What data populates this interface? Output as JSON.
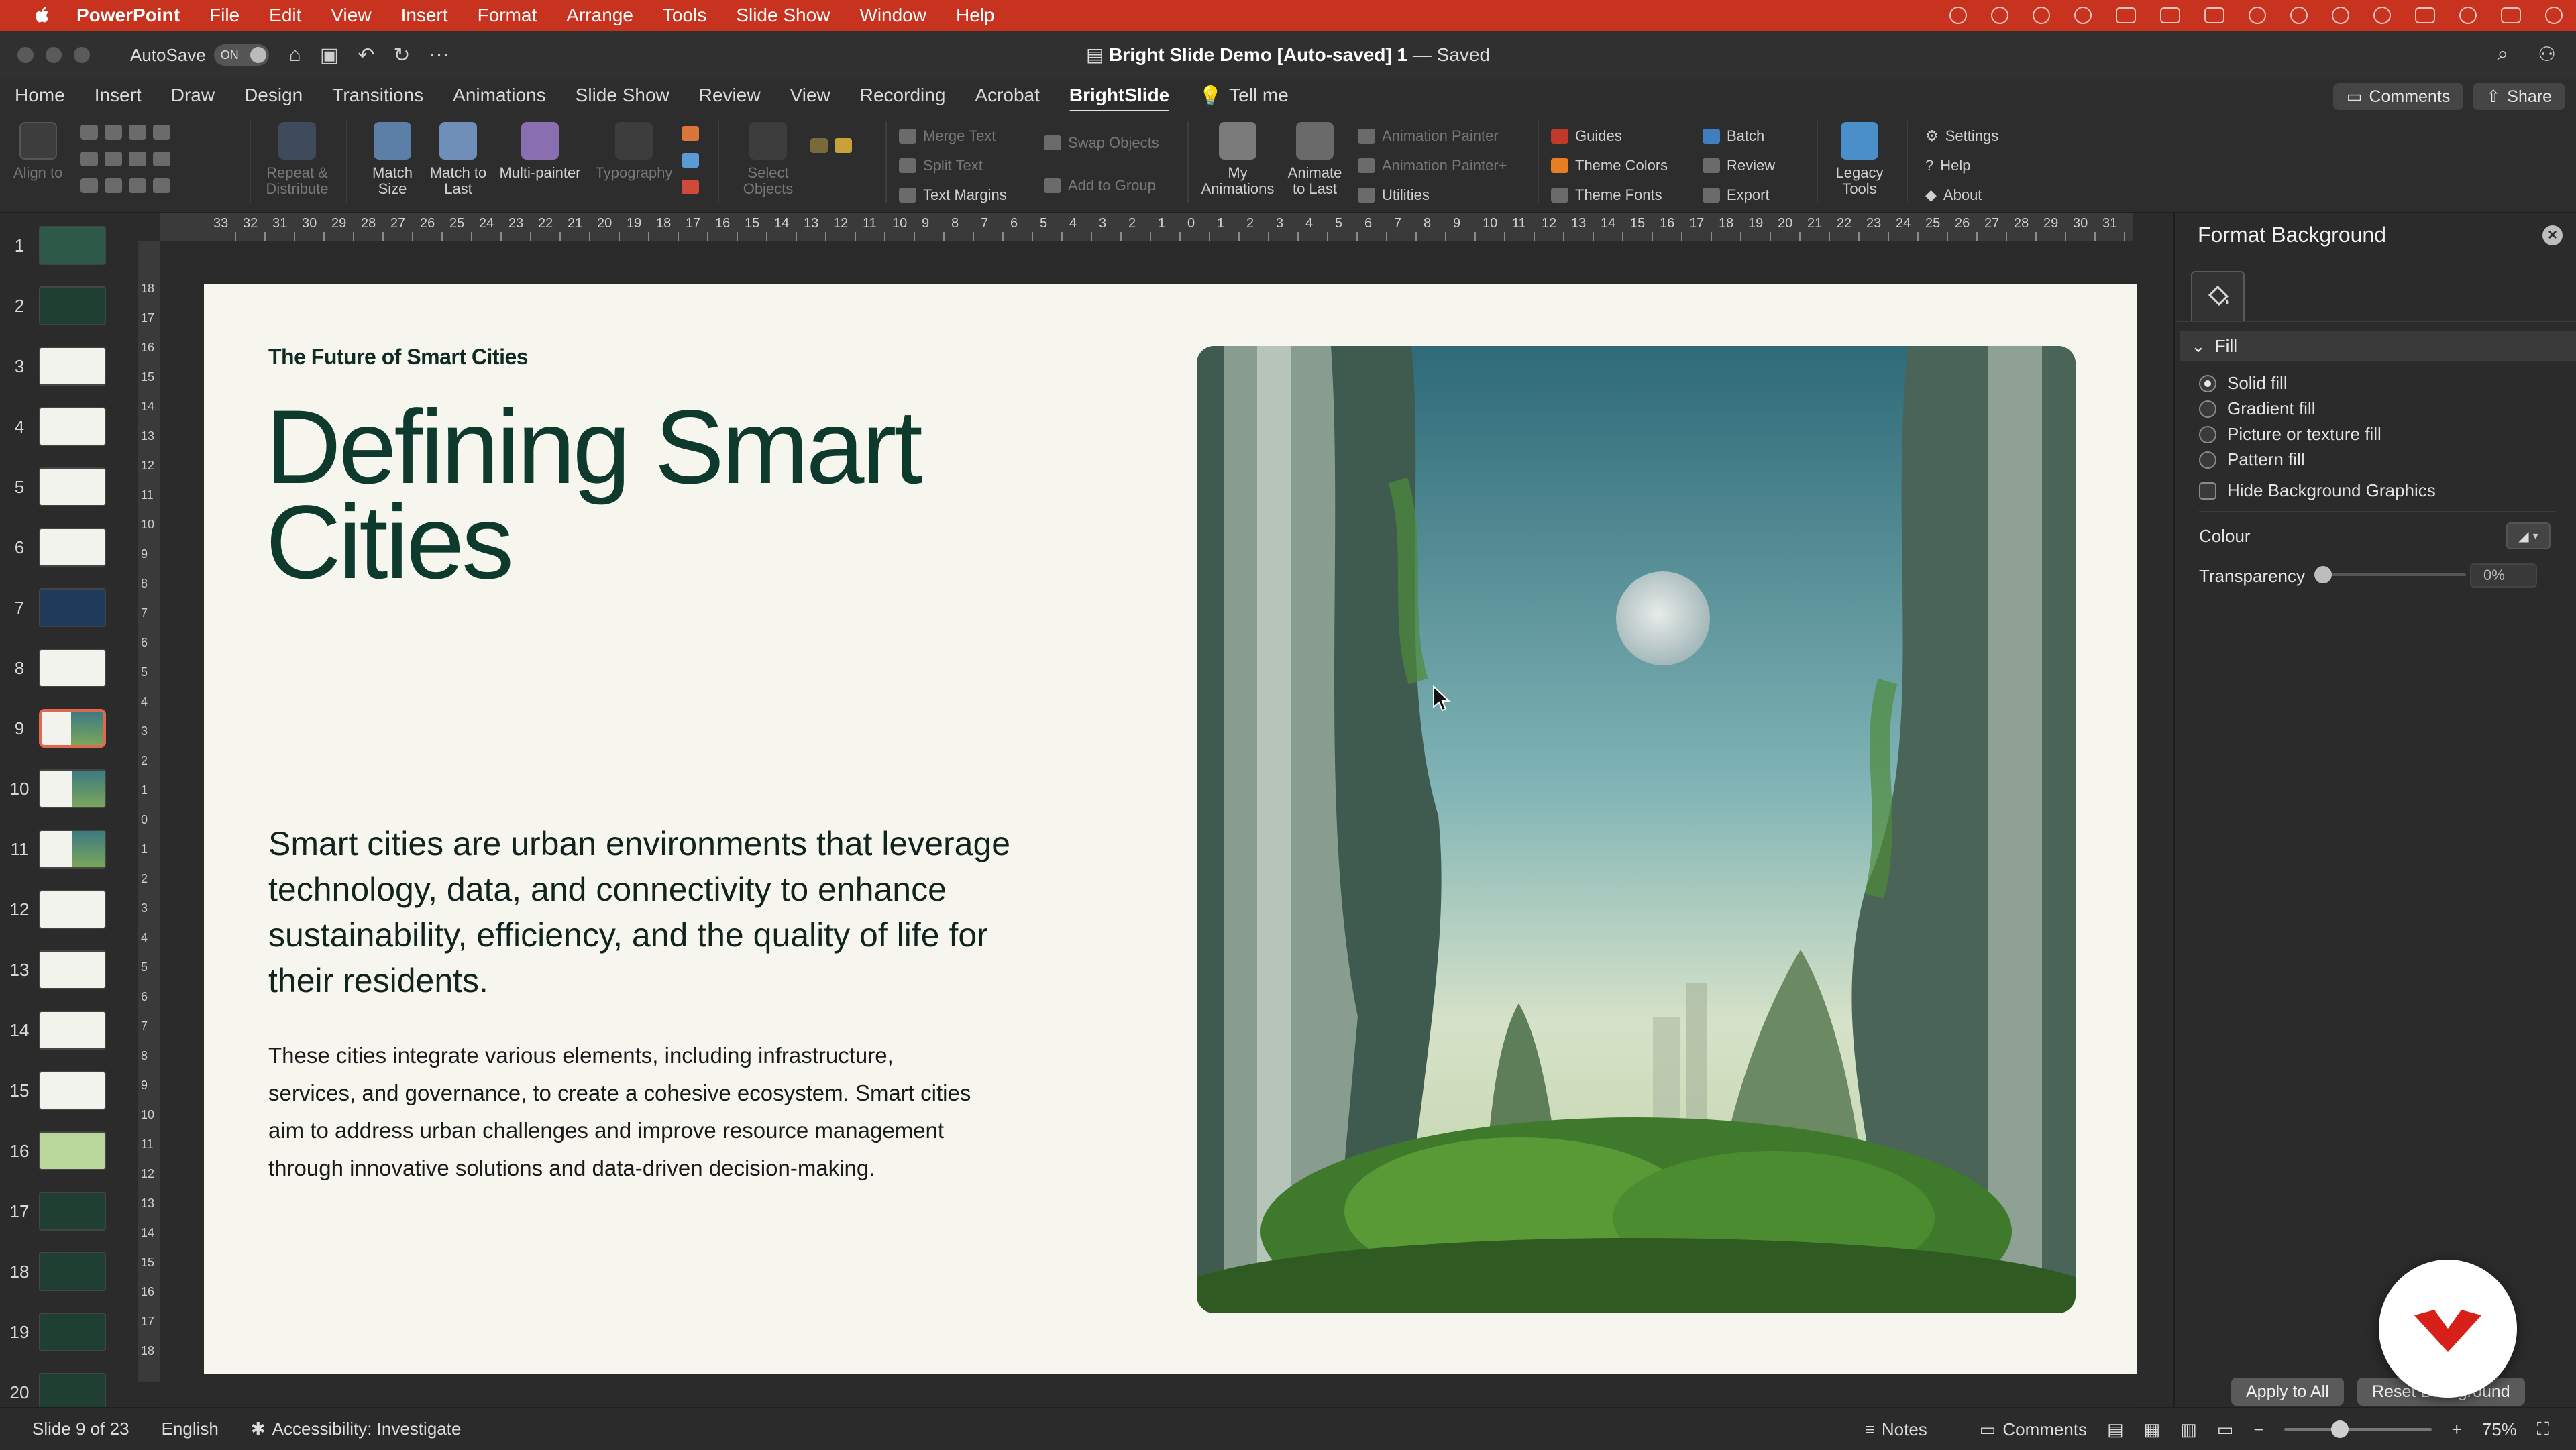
{
  "menubar": {
    "app": "PowerPoint",
    "items": [
      "File",
      "Edit",
      "View",
      "Insert",
      "Format",
      "Arrange",
      "Tools",
      "Slide Show",
      "Window",
      "Help"
    ]
  },
  "titlebar": {
    "autosave_label": "AutoSave",
    "autosave_state": "ON",
    "doc_name": "Bright Slide Demo [Auto-saved] 1",
    "doc_status": " — Saved"
  },
  "tabs": {
    "items": [
      "Home",
      "Insert",
      "Draw",
      "Design",
      "Transitions",
      "Animations",
      "Slide Show",
      "Review",
      "View",
      "Recording",
      "Acrobat",
      "BrightSlide"
    ],
    "active": "BrightSlide",
    "tell_me": "Tell me",
    "comments_btn": "Comments",
    "share_btn": "Share"
  },
  "ribbon": {
    "align_to": "Align to",
    "repeat_distribute": "Repeat & Distribute",
    "match_size": "Match Size",
    "match_to_last": "Match to Last",
    "multi_painter": "Multi-painter",
    "typography": "Typography",
    "select_objects": "Select Objects",
    "merge_text": "Merge Text",
    "split_text": "Split Text",
    "text_margins": "Text Margins",
    "swap_objects": "Swap Objects",
    "add_to_group": "Add to Group",
    "my_animations": "My Animations",
    "animate_to_last": "Animate to Last",
    "animation_painter": "Animation Painter",
    "animation_painter_plus": "Animation Painter+",
    "utilities": "Utilities",
    "guides": "Guides",
    "theme_colors": "Theme Colors",
    "theme_fonts": "Theme Fonts",
    "batch": "Batch",
    "review": "Review",
    "export": "Export",
    "legacy_tools": "Legacy Tools",
    "settings": "Settings",
    "help": "Help",
    "about": "About"
  },
  "thumbnails": {
    "numbers": [
      "1",
      "2",
      "3",
      "4",
      "5",
      "6",
      "7",
      "8",
      "9",
      "10",
      "11",
      "12",
      "13",
      "14",
      "15",
      "16",
      "17",
      "18",
      "19",
      "20"
    ],
    "selected": "9"
  },
  "ruler": {
    "h_labels": [
      "33",
      "32",
      "31",
      "30",
      "29",
      "28",
      "27",
      "26",
      "25",
      "24",
      "23",
      "22",
      "21",
      "20",
      "19",
      "18",
      "17",
      "16",
      "15",
      "14",
      "13",
      "12",
      "11",
      "10",
      "9",
      "8",
      "7",
      "6",
      "5",
      "4",
      "3",
      "2",
      "1",
      "0",
      "1",
      "2",
      "3",
      "4",
      "5",
      "6",
      "7",
      "8",
      "9",
      "10",
      "11",
      "12",
      "13",
      "14",
      "15",
      "16",
      "17",
      "18",
      "19",
      "20",
      "21",
      "22",
      "23",
      "24",
      "25",
      "26",
      "27",
      "28",
      "29",
      "30",
      "31",
      "32",
      "33"
    ],
    "v_labels": [
      "18",
      "17",
      "16",
      "15",
      "14",
      "13",
      "12",
      "11",
      "10",
      "9",
      "8",
      "7",
      "6",
      "5",
      "4",
      "3",
      "2",
      "1",
      "0",
      "1",
      "2",
      "3",
      "4",
      "5",
      "6",
      "7",
      "8",
      "9",
      "10",
      "11",
      "12",
      "13",
      "14",
      "15",
      "16",
      "17",
      "18"
    ]
  },
  "slide": {
    "kicker": "The Future of Smart Cities",
    "title_line1": "Defining Smart",
    "title_line2": "Cities",
    "lead": "Smart cities are urban environments that leverage technology, data, and connectivity to enhance sustainability, efficiency, and the quality of life for their residents.",
    "body": "These cities integrate various elements, including infrastructure, services, and governance, to create a cohesive ecosystem. Smart cities aim to address urban challenges and improve resource management through innovative solutions and data-driven decision-making."
  },
  "format_pane": {
    "title": "Format Background",
    "section": "Fill",
    "options": [
      "Solid fill",
      "Gradient fill",
      "Picture or texture fill",
      "Pattern fill"
    ],
    "selected_option": "Solid fill",
    "hide_bg_graphics": "Hide Background Graphics",
    "colour_label": "Colour",
    "transparency_label": "Transparency",
    "transparency_value": "0%",
    "apply_all": "Apply to All",
    "reset_bg": "Reset Background"
  },
  "status": {
    "slide_info": "Slide 9 of 23",
    "language": "English",
    "accessibility": "Accessibility: Investigate",
    "notes": "Notes",
    "comments": "Comments",
    "zoom": "75%"
  },
  "colors": {
    "menubar": "#c8331f",
    "slide_bg": "#f6f6ef",
    "title_green": "#0d3a2c",
    "accent_red": "#e0684f"
  }
}
